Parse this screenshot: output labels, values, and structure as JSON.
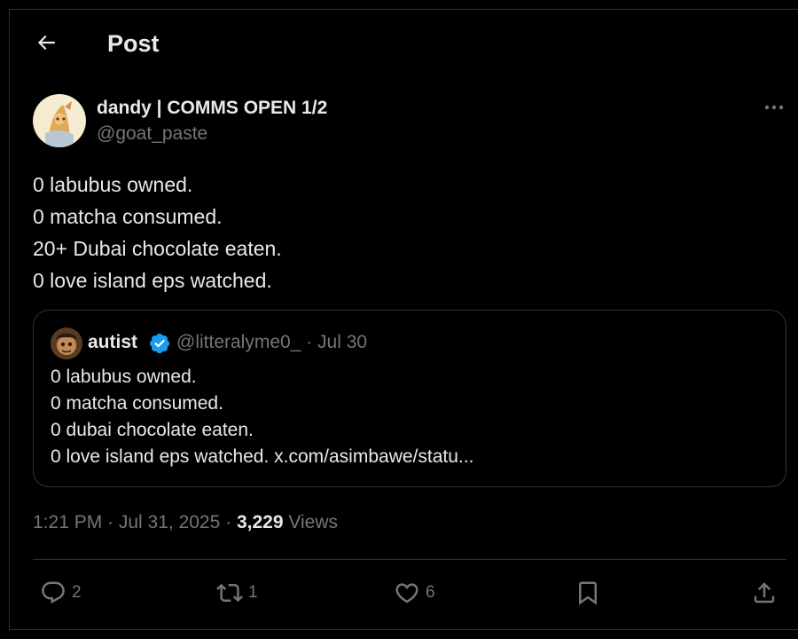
{
  "header": {
    "title": "Post"
  },
  "author": {
    "name": "dandy | COMMS OPEN 1/2",
    "handle": "@goat_paste"
  },
  "tweet": {
    "lines": [
      "0 labubus owned.",
      "0 matcha consumed.",
      "20+ Dubai chocolate eaten.",
      "0 love island eps watched."
    ]
  },
  "quote": {
    "name": "autist",
    "handle_date": "@litteralyme0_ · Jul 30",
    "lines": [
      "0 labubus owned.",
      "0 matcha consumed.",
      "0 dubai chocolate eaten.",
      "0 love island eps watched. x.com/asimbawe/statu..."
    ]
  },
  "meta": {
    "time_date": "1:21 PM · Jul 31, 2025 · ",
    "views_count": "3,229",
    "views_label": " Views"
  },
  "actions": {
    "replies": "2",
    "reposts": "1",
    "likes": "6"
  },
  "colors": {
    "background": "#000000",
    "text": "#e7e9ea",
    "muted": "#71767b",
    "border": "#2f3336",
    "verified": "#1d9bf0"
  }
}
